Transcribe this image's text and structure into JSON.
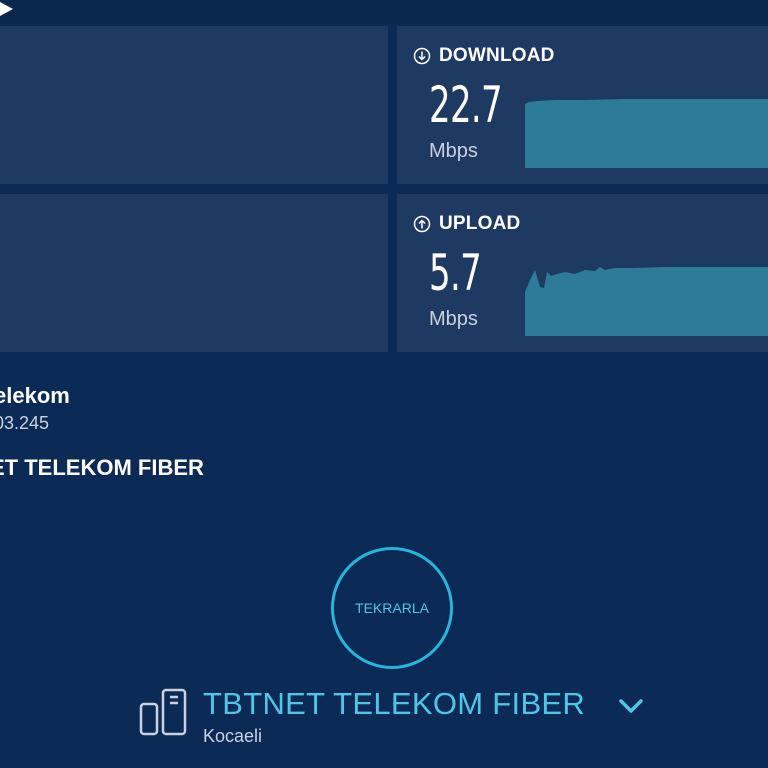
{
  "colors": {
    "background": "#0b2a56",
    "panel": "#1f3a62",
    "accent": "#27b5d8",
    "graph": "#2d7a99"
  },
  "icons": {
    "play": "play-icon",
    "download": "arrow-down-circle-icon",
    "upload": "arrow-up-circle-icon",
    "server": "server-icon",
    "chevron": "chevron-down-icon"
  },
  "download": {
    "label": "DOWNLOAD",
    "value": "22.7",
    "unit": "Mbps"
  },
  "upload": {
    "label": "UPLOAD",
    "value": "5.7",
    "unit": "Mbps"
  },
  "connection": {
    "isp_name": "elekom",
    "ip": "03.245",
    "server_name": "ET TELEKOM FIBER"
  },
  "retry_button": {
    "label": "TEKRARLA"
  },
  "provider": {
    "name": "TBTNET TELEKOM FIBER",
    "location": "Kocaeli"
  }
}
